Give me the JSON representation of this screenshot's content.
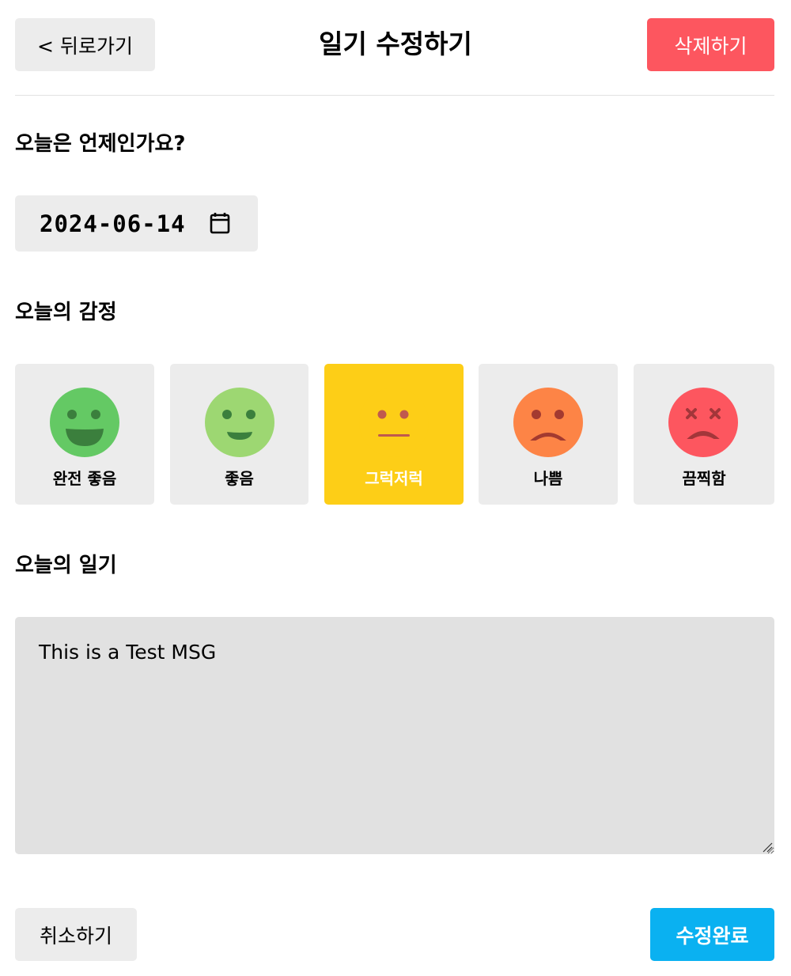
{
  "header": {
    "back_label": "< 뒤로가기",
    "title": "일기 수정하기",
    "delete_label": "삭제하기"
  },
  "date_section": {
    "title": "오늘은 언제인가요?",
    "date_value": "2024-06-14",
    "icon": "calendar-icon"
  },
  "emotion_section": {
    "title": "오늘의 감정",
    "selected": "그럭저럭",
    "items": [
      {
        "label": "완전 좋음",
        "color": "#64c964",
        "icon": "very-happy-face-icon"
      },
      {
        "label": "좋음",
        "color": "#9dd772",
        "icon": "happy-face-icon"
      },
      {
        "label": "그럭저럭",
        "color": "#fdce17",
        "icon": "neutral-face-icon"
      },
      {
        "label": "나쁨",
        "color": "#fd8446",
        "icon": "sad-face-icon"
      },
      {
        "label": "끔찍함",
        "color": "#fd565f",
        "icon": "terrible-face-icon"
      }
    ]
  },
  "content_section": {
    "title": "오늘의 일기",
    "text": "This is a Test MSG"
  },
  "footer": {
    "cancel_label": "취소하기",
    "submit_label": "수정완료"
  },
  "colors": {
    "negative": "#fd565f",
    "positive": "#0ab1f1",
    "default_bg": "#ececec",
    "textarea_bg": "#e1e1e1"
  }
}
